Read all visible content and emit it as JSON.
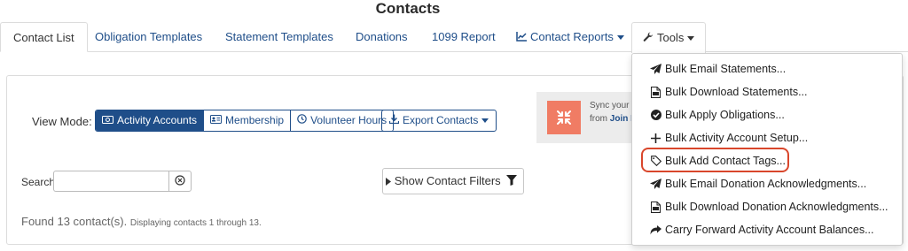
{
  "page": {
    "title": "Contacts"
  },
  "tabs": [
    {
      "label": "Contact List",
      "active": true
    },
    {
      "label": "Obligation Templates"
    },
    {
      "label": "Statement Templates"
    },
    {
      "label": "Donations"
    },
    {
      "label": "1099 Report"
    },
    {
      "label": "Contact Reports",
      "icon": "line-chart-icon",
      "dropdown": true
    },
    {
      "label": "Tools",
      "icon": "wrench-icon",
      "dropdown": true,
      "open": true
    }
  ],
  "view_mode": {
    "label": "View Mode:",
    "options": [
      {
        "label": "Activity Accounts",
        "icon": "money-icon",
        "selected": true
      },
      {
        "label": "Membership",
        "icon": "id-card-icon"
      },
      {
        "label": "Volunteer Hours",
        "icon": "clock-icon"
      }
    ]
  },
  "export": {
    "label": "Export Contacts",
    "icon": "download-icon"
  },
  "sync": {
    "line1": "Sync your l",
    "line2_prefix": "from",
    "line2_link": "Join It"
  },
  "search": {
    "label": "Search",
    "value": "",
    "placeholder": ""
  },
  "filters": {
    "label": "Show Contact Filters"
  },
  "results": {
    "found": "Found 13 contact(s).",
    "displaying": "Displaying contacts 1 through 13."
  },
  "tools_menu": {
    "items": [
      {
        "label": "Bulk Email Statements...",
        "icon": "paper-plane-icon"
      },
      {
        "label": "Bulk Download Statements...",
        "icon": "file-pdf-icon"
      },
      {
        "label": "Bulk Apply Obligations...",
        "icon": "check-circle-icon"
      },
      {
        "label": "Bulk Activity Account Setup...",
        "icon": "plus-icon"
      },
      {
        "label": "Bulk Add Contact Tags...",
        "icon": "tag-icon",
        "highlighted": true
      },
      {
        "label": "Bulk Email Donation Acknowledgments...",
        "icon": "paper-plane-icon"
      },
      {
        "label": "Bulk Download Donation Acknowledgments...",
        "icon": "file-pdf-icon"
      },
      {
        "label": "Carry Forward Activity Account Balances...",
        "icon": "share-icon"
      }
    ]
  },
  "colors": {
    "brand_blue": "#1f4e89",
    "highlight_ring": "#d9462b",
    "sync_accent": "#f07c64"
  }
}
